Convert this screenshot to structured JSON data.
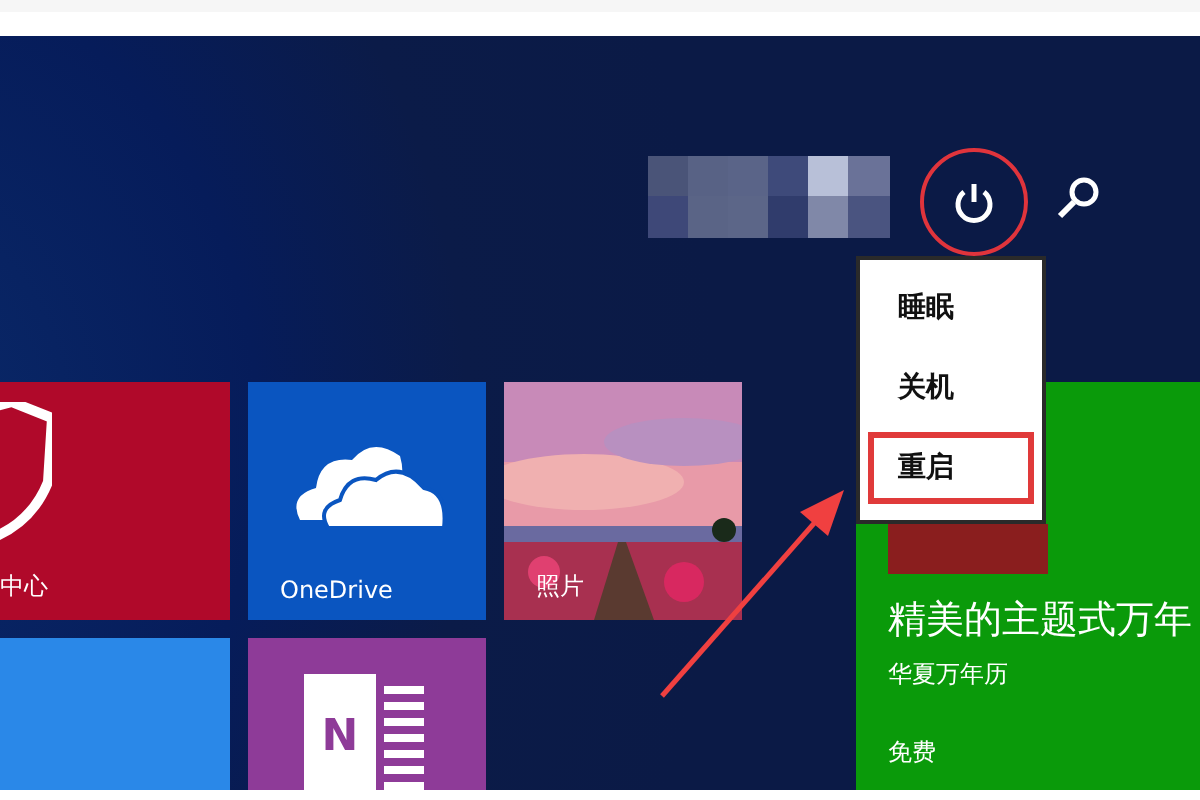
{
  "tiles": [
    {
      "kind": "shield",
      "label": "中心",
      "color": "#b0092a"
    },
    {
      "kind": "cloud",
      "label": "OneDrive",
      "color": "#0a55c0"
    },
    {
      "label": "照片"
    },
    {
      "kind": "plain",
      "color": "#2a88e8"
    },
    {
      "kind": "notebook",
      "glyph": "N",
      "color": "#8e3b98"
    }
  ],
  "power_menu": {
    "items": [
      {
        "label": "睡眠",
        "highlighted": false
      },
      {
        "label": "关机",
        "highlighted": false
      },
      {
        "label": "重启",
        "highlighted": true
      }
    ]
  },
  "app_tile": {
    "title": "精美的主题式万年",
    "publisher": "华夏万年历",
    "price": "免费"
  }
}
